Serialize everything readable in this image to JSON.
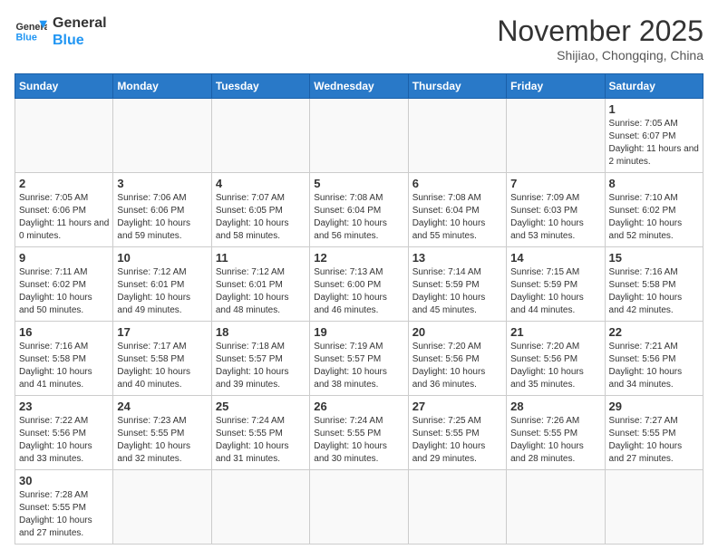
{
  "logo": {
    "line1": "General",
    "line2": "Blue"
  },
  "title": "November 2025",
  "subtitle": "Shijiao, Chongqing, China",
  "days_of_week": [
    "Sunday",
    "Monday",
    "Tuesday",
    "Wednesday",
    "Thursday",
    "Friday",
    "Saturday"
  ],
  "weeks": [
    [
      {
        "day": null,
        "info": null
      },
      {
        "day": null,
        "info": null
      },
      {
        "day": null,
        "info": null
      },
      {
        "day": null,
        "info": null
      },
      {
        "day": null,
        "info": null
      },
      {
        "day": null,
        "info": null
      },
      {
        "day": "1",
        "info": "Sunrise: 7:05 AM\nSunset: 6:07 PM\nDaylight: 11 hours and 2 minutes."
      }
    ],
    [
      {
        "day": "2",
        "info": "Sunrise: 7:05 AM\nSunset: 6:06 PM\nDaylight: 11 hours and 0 minutes."
      },
      {
        "day": "3",
        "info": "Sunrise: 7:06 AM\nSunset: 6:06 PM\nDaylight: 10 hours and 59 minutes."
      },
      {
        "day": "4",
        "info": "Sunrise: 7:07 AM\nSunset: 6:05 PM\nDaylight: 10 hours and 58 minutes."
      },
      {
        "day": "5",
        "info": "Sunrise: 7:08 AM\nSunset: 6:04 PM\nDaylight: 10 hours and 56 minutes."
      },
      {
        "day": "6",
        "info": "Sunrise: 7:08 AM\nSunset: 6:04 PM\nDaylight: 10 hours and 55 minutes."
      },
      {
        "day": "7",
        "info": "Sunrise: 7:09 AM\nSunset: 6:03 PM\nDaylight: 10 hours and 53 minutes."
      },
      {
        "day": "8",
        "info": "Sunrise: 7:10 AM\nSunset: 6:02 PM\nDaylight: 10 hours and 52 minutes."
      }
    ],
    [
      {
        "day": "9",
        "info": "Sunrise: 7:11 AM\nSunset: 6:02 PM\nDaylight: 10 hours and 50 minutes."
      },
      {
        "day": "10",
        "info": "Sunrise: 7:12 AM\nSunset: 6:01 PM\nDaylight: 10 hours and 49 minutes."
      },
      {
        "day": "11",
        "info": "Sunrise: 7:12 AM\nSunset: 6:01 PM\nDaylight: 10 hours and 48 minutes."
      },
      {
        "day": "12",
        "info": "Sunrise: 7:13 AM\nSunset: 6:00 PM\nDaylight: 10 hours and 46 minutes."
      },
      {
        "day": "13",
        "info": "Sunrise: 7:14 AM\nSunset: 5:59 PM\nDaylight: 10 hours and 45 minutes."
      },
      {
        "day": "14",
        "info": "Sunrise: 7:15 AM\nSunset: 5:59 PM\nDaylight: 10 hours and 44 minutes."
      },
      {
        "day": "15",
        "info": "Sunrise: 7:16 AM\nSunset: 5:58 PM\nDaylight: 10 hours and 42 minutes."
      }
    ],
    [
      {
        "day": "16",
        "info": "Sunrise: 7:16 AM\nSunset: 5:58 PM\nDaylight: 10 hours and 41 minutes."
      },
      {
        "day": "17",
        "info": "Sunrise: 7:17 AM\nSunset: 5:58 PM\nDaylight: 10 hours and 40 minutes."
      },
      {
        "day": "18",
        "info": "Sunrise: 7:18 AM\nSunset: 5:57 PM\nDaylight: 10 hours and 39 minutes."
      },
      {
        "day": "19",
        "info": "Sunrise: 7:19 AM\nSunset: 5:57 PM\nDaylight: 10 hours and 38 minutes."
      },
      {
        "day": "20",
        "info": "Sunrise: 7:20 AM\nSunset: 5:56 PM\nDaylight: 10 hours and 36 minutes."
      },
      {
        "day": "21",
        "info": "Sunrise: 7:20 AM\nSunset: 5:56 PM\nDaylight: 10 hours and 35 minutes."
      },
      {
        "day": "22",
        "info": "Sunrise: 7:21 AM\nSunset: 5:56 PM\nDaylight: 10 hours and 34 minutes."
      }
    ],
    [
      {
        "day": "23",
        "info": "Sunrise: 7:22 AM\nSunset: 5:56 PM\nDaylight: 10 hours and 33 minutes."
      },
      {
        "day": "24",
        "info": "Sunrise: 7:23 AM\nSunset: 5:55 PM\nDaylight: 10 hours and 32 minutes."
      },
      {
        "day": "25",
        "info": "Sunrise: 7:24 AM\nSunset: 5:55 PM\nDaylight: 10 hours and 31 minutes."
      },
      {
        "day": "26",
        "info": "Sunrise: 7:24 AM\nSunset: 5:55 PM\nDaylight: 10 hours and 30 minutes."
      },
      {
        "day": "27",
        "info": "Sunrise: 7:25 AM\nSunset: 5:55 PM\nDaylight: 10 hours and 29 minutes."
      },
      {
        "day": "28",
        "info": "Sunrise: 7:26 AM\nSunset: 5:55 PM\nDaylight: 10 hours and 28 minutes."
      },
      {
        "day": "29",
        "info": "Sunrise: 7:27 AM\nSunset: 5:55 PM\nDaylight: 10 hours and 27 minutes."
      }
    ],
    [
      {
        "day": "30",
        "info": "Sunrise: 7:28 AM\nSunset: 5:55 PM\nDaylight: 10 hours and 27 minutes."
      },
      {
        "day": null,
        "info": null
      },
      {
        "day": null,
        "info": null
      },
      {
        "day": null,
        "info": null
      },
      {
        "day": null,
        "info": null
      },
      {
        "day": null,
        "info": null
      },
      {
        "day": null,
        "info": null
      }
    ]
  ]
}
